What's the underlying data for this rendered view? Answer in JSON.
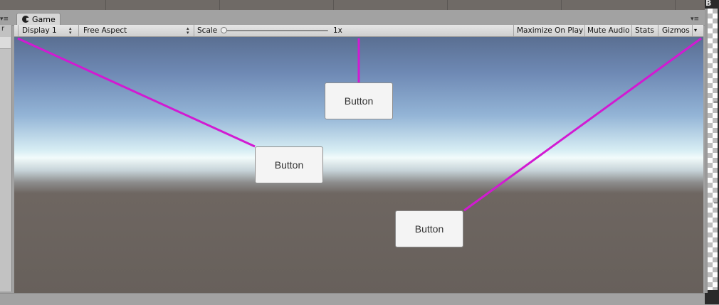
{
  "tab": {
    "title": "Game",
    "icon": "unity-game-icon"
  },
  "right_panel": {
    "label": "B"
  },
  "toolbar": {
    "display": "Display 1",
    "aspect": "Free Aspect",
    "scale_label": "Scale",
    "scale_value": "1x",
    "maximize_on_play": "Maximize On Play",
    "mute_audio": "Mute Audio",
    "stats": "Stats",
    "gizmos": "Gizmos"
  },
  "scene": {
    "buttons": [
      {
        "label": "Button"
      },
      {
        "label": "Button"
      },
      {
        "label": "Button"
      }
    ],
    "line_color": "#d21ad2"
  }
}
